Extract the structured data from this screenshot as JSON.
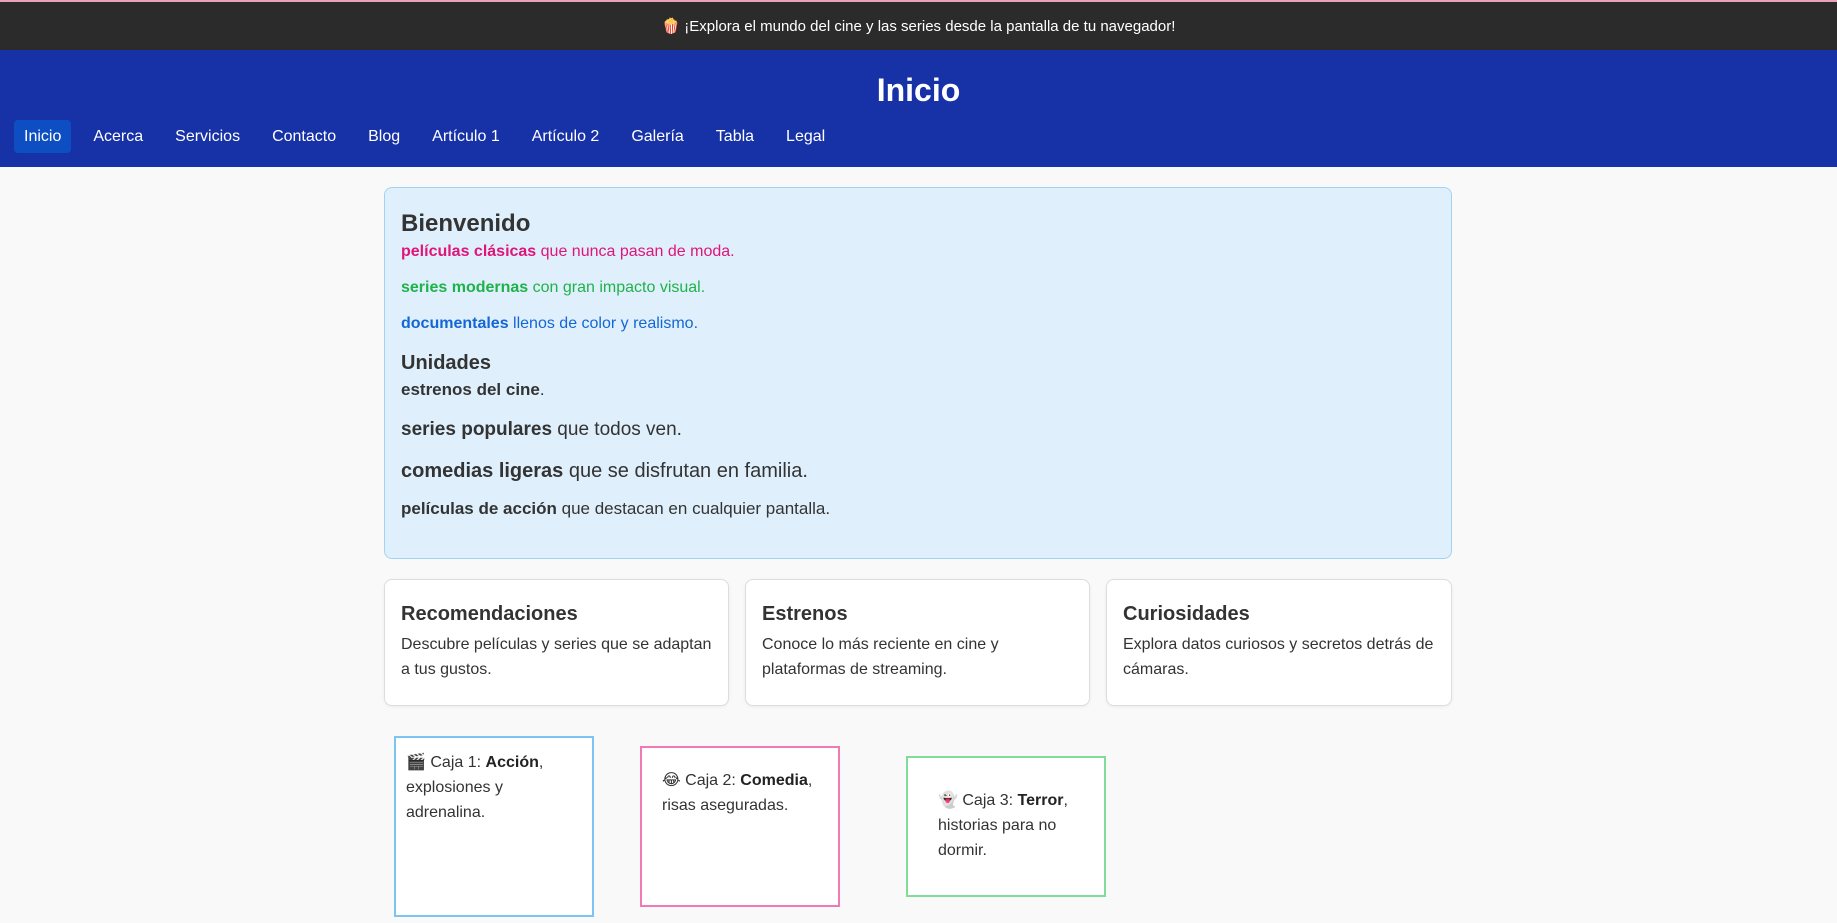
{
  "announcement": {
    "icon": "popcorn-icon",
    "text": "¡Explora el mundo del cine y las series desde la pantalla de tu navegador!"
  },
  "header": {
    "title": "Inicio"
  },
  "nav": {
    "active": "Inicio",
    "items": [
      "Inicio",
      "Acerca",
      "Servicios",
      "Contacto",
      "Blog",
      "Artículo 1",
      "Artículo 2",
      "Galería",
      "Tabla",
      "Legal"
    ]
  },
  "welcome": {
    "title": "Bienvenido",
    "genres": [
      {
        "strong": "películas clásicas",
        "rest": " que nunca pasan de moda.",
        "color": "#e0147a"
      },
      {
        "strong": "series modernas",
        "rest": " con gran impacto visual.",
        "color": "#1fb24a"
      },
      {
        "strong": "documentales",
        "rest": " llenos de color y realismo.",
        "color": "#1466d6"
      }
    ],
    "units_title": "Unidades",
    "units": [
      {
        "strong": "estrenos del cine",
        "rest": "."
      },
      {
        "strong": "series populares",
        "rest": " que todos ven."
      },
      {
        "strong": "comedias ligeras",
        "rest": " que se disfrutan en familia."
      },
      {
        "strong": "películas de acción",
        "rest": " que destacan en cualquier pantalla."
      }
    ]
  },
  "cards": [
    {
      "title": "Recomendaciones",
      "text": "Descubre películas y series que se adaptan a tus gustos."
    },
    {
      "title": "Estrenos",
      "text": "Conoce lo más reciente en cine y plataformas de streaming."
    },
    {
      "title": "Curiosidades",
      "text": "Explora datos curiosos y secretos detrás de cámaras."
    }
  ],
  "boxes": [
    {
      "icon": "clapperboard-icon",
      "prefix": "Caja 1: ",
      "strong": "Acción",
      "rest": ", explosiones y adrenalina.",
      "border": "#7cc4f2"
    },
    {
      "icon": "laughing-face-icon",
      "prefix": "Caja 2: ",
      "strong": "Comedia",
      "rest": ", risas aseguradas.",
      "border": "#f07bb4"
    },
    {
      "icon": "ghost-icon",
      "prefix": "Caja 3: ",
      "strong": "Terror",
      "rest": ", historias para no dormir.",
      "border": "#7fdc9b"
    }
  ]
}
